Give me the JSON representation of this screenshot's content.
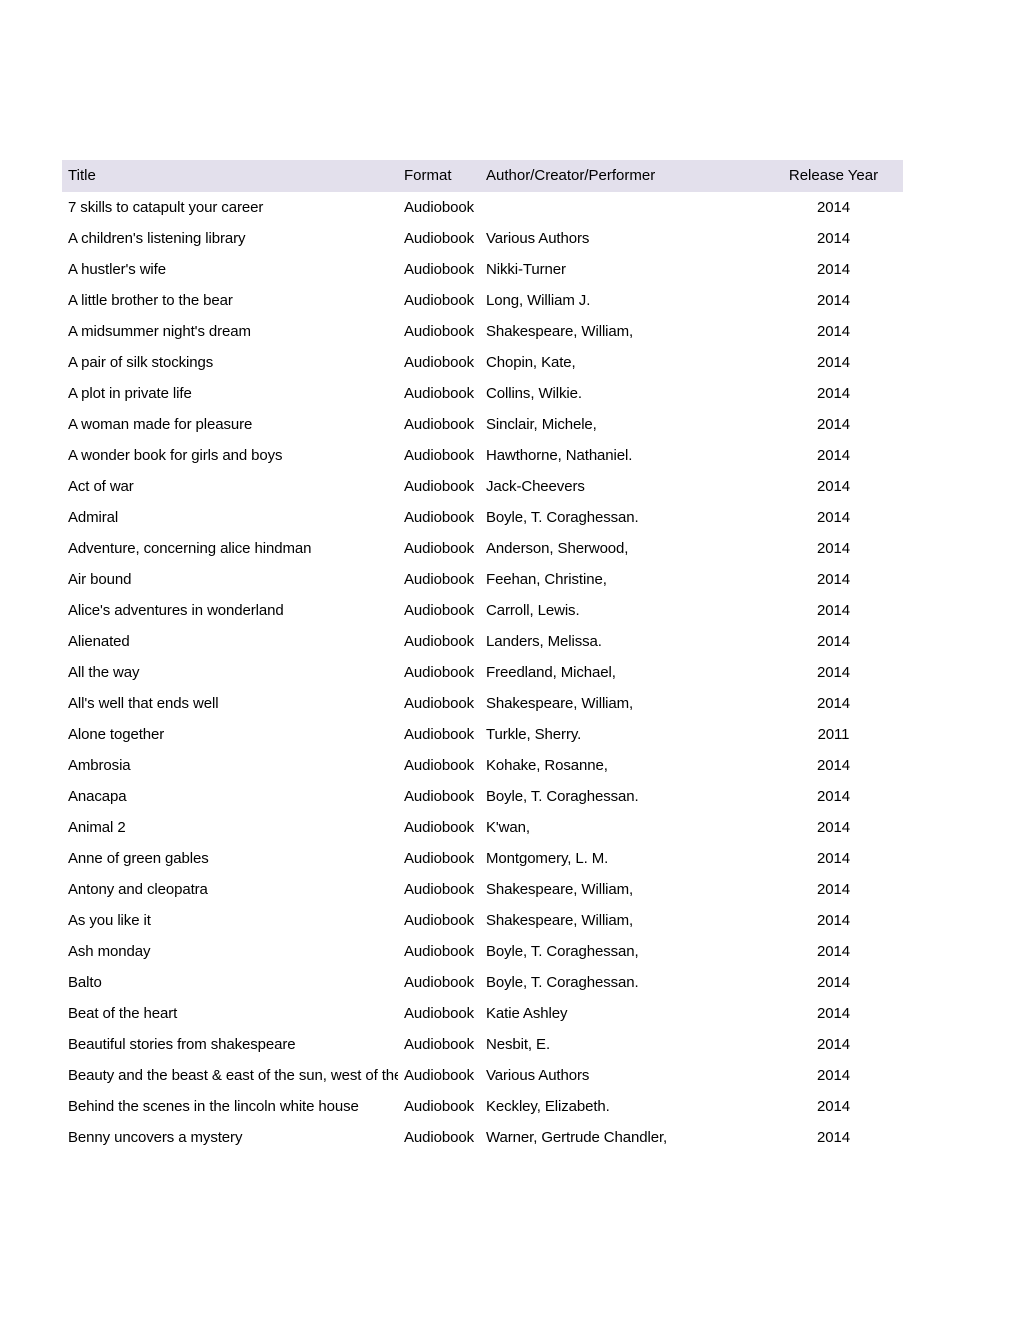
{
  "table": {
    "columns": [
      {
        "key": "title",
        "label": "Title"
      },
      {
        "key": "format",
        "label": "Format"
      },
      {
        "key": "author",
        "label": "Author/Creator/Performer"
      },
      {
        "key": "year",
        "label": "Release Year"
      }
    ],
    "header_background": "#e3e0ec",
    "rows": [
      {
        "title": "7 skills to catapult your career",
        "format": "Audiobook",
        "author": "",
        "year": "2014"
      },
      {
        "title": "A children's listening library",
        "format": "Audiobook",
        "author": "Various Authors",
        "year": "2014"
      },
      {
        "title": "A hustler's wife",
        "format": "Audiobook",
        "author": "Nikki-Turner",
        "year": "2014"
      },
      {
        "title": "A little brother to the bear",
        "format": "Audiobook",
        "author": "Long, William J.",
        "year": "2014"
      },
      {
        "title": "A midsummer night's dream",
        "format": "Audiobook",
        "author": "Shakespeare, William,",
        "year": "2014"
      },
      {
        "title": "A pair of silk stockings",
        "format": "Audiobook",
        "author": "Chopin, Kate,",
        "year": "2014"
      },
      {
        "title": "A plot in private life",
        "format": "Audiobook",
        "author": "Collins, Wilkie.",
        "year": "2014"
      },
      {
        "title": "A woman made for pleasure",
        "format": "Audiobook",
        "author": "Sinclair, Michele,",
        "year": "2014"
      },
      {
        "title": "A wonder book for girls and boys",
        "format": "Audiobook",
        "author": "Hawthorne, Nathaniel.",
        "year": "2014"
      },
      {
        "title": "Act of war",
        "format": "Audiobook",
        "author": "Jack-Cheevers",
        "year": "2014"
      },
      {
        "title": "Admiral",
        "format": "Audiobook",
        "author": "Boyle, T. Coraghessan.",
        "year": "2014"
      },
      {
        "title": "Adventure, concerning alice hindman",
        "format": "Audiobook",
        "author": "Anderson, Sherwood,",
        "year": "2014"
      },
      {
        "title": "Air bound",
        "format": "Audiobook",
        "author": "Feehan, Christine,",
        "year": "2014"
      },
      {
        "title": "Alice's adventures in wonderland",
        "format": "Audiobook",
        "author": "Carroll, Lewis.",
        "year": "2014"
      },
      {
        "title": "Alienated",
        "format": "Audiobook",
        "author": "Landers, Melissa.",
        "year": "2014"
      },
      {
        "title": "All the way",
        "format": "Audiobook",
        "author": "Freedland, Michael,",
        "year": "2014"
      },
      {
        "title": "All's well that ends well",
        "format": "Audiobook",
        "author": "Shakespeare, William,",
        "year": "2014"
      },
      {
        "title": "Alone together",
        "format": "Audiobook",
        "author": "Turkle, Sherry.",
        "year": "2011"
      },
      {
        "title": "Ambrosia",
        "format": "Audiobook",
        "author": "Kohake, Rosanne,",
        "year": "2014"
      },
      {
        "title": "Anacapa",
        "format": "Audiobook",
        "author": "Boyle, T. Coraghessan.",
        "year": "2014"
      },
      {
        "title": "Animal 2",
        "format": "Audiobook",
        "author": "K'wan,",
        "year": "2014"
      },
      {
        "title": "Anne of green gables",
        "format": "Audiobook",
        "author": "Montgomery, L. M.",
        "year": "2014"
      },
      {
        "title": "Antony and cleopatra",
        "format": "Audiobook",
        "author": "Shakespeare, William,",
        "year": "2014"
      },
      {
        "title": "As you like it",
        "format": "Audiobook",
        "author": "Shakespeare, William,",
        "year": "2014"
      },
      {
        "title": "Ash monday",
        "format": "Audiobook",
        "author": "Boyle, T. Coraghessan,",
        "year": "2014"
      },
      {
        "title": "Balto",
        "format": "Audiobook",
        "author": "Boyle, T. Coraghessan.",
        "year": "2014"
      },
      {
        "title": "Beat of the heart",
        "format": "Audiobook",
        "author": "Katie Ashley",
        "year": "2014"
      },
      {
        "title": "Beautiful stories from shakespeare",
        "format": "Audiobook",
        "author": "Nesbit, E.",
        "year": "2014"
      },
      {
        "title": "Beauty and the beast & east of the sun, west of the moo",
        "format": "Audiobook",
        "author": "Various Authors",
        "year": "2014"
      },
      {
        "title": "Behind the scenes in the lincoln white house",
        "format": "Audiobook",
        "author": "Keckley, Elizabeth.",
        "year": "2014"
      },
      {
        "title": "Benny uncovers a mystery",
        "format": "Audiobook",
        "author": "Warner, Gertrude Chandler,",
        "year": "2014"
      }
    ]
  }
}
